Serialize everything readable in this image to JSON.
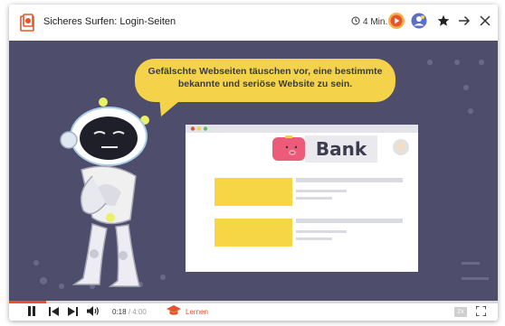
{
  "header": {
    "title": "Sicheres Surfen: Login-Seiten",
    "duration": "4 Min."
  },
  "stage": {
    "speech_bubble": "Gefälschte Webseiten täuschen vor, eine bestimmte bekannte und seriöse Website zu sein.",
    "bank_label": "Bank"
  },
  "player": {
    "current_time": "0:18",
    "total_time": "4:00",
    "progress": 0.075,
    "learn_label": "Lernen",
    "speed_label": "2x"
  },
  "colors": {
    "accent": "#e8542a",
    "stage_bg": "#4e4d6b",
    "bubble": "#f4d34a",
    "profile_blue": "#5b6fc9"
  },
  "icons": {
    "header": [
      "app-logo-icon",
      "clock-icon",
      "play-circle-icon",
      "avatar-icon",
      "star-icon",
      "arrow-right-icon",
      "close-icon"
    ],
    "controls": [
      "pause-icon",
      "skip-previous-icon",
      "skip-next-icon",
      "volume-icon",
      "graduation-cap-icon",
      "fullscreen-icon"
    ]
  }
}
